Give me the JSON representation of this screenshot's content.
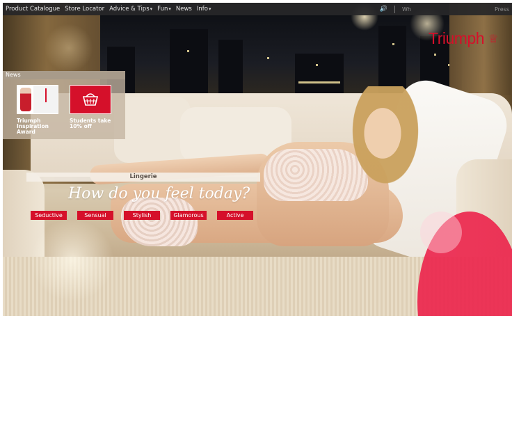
{
  "nav": {
    "items": [
      {
        "label": "Product Catalogue",
        "has_menu": false
      },
      {
        "label": "Store Locator",
        "has_menu": false
      },
      {
        "label": "Advice & Tips",
        "has_menu": true
      },
      {
        "label": "Fun",
        "has_menu": true
      },
      {
        "label": "News",
        "has_menu": false
      },
      {
        "label": "Info",
        "has_menu": true
      }
    ],
    "right_faint_1": "Wh",
    "right_faint_2": "Press"
  },
  "brand": {
    "name": "Triumph",
    "color": "#d5102a"
  },
  "news": {
    "heading": "News",
    "tiles": [
      {
        "label": "Triumph Inspiration Award",
        "thumb_icon": "award-model-thumbnail"
      },
      {
        "label": "Students take 10% off",
        "thumb_icon": "shopping-basket-icon"
      }
    ]
  },
  "lingerie": {
    "heading": "Lingerie",
    "tagline": "How do you feel today?",
    "moods": [
      "Seductive",
      "Sensual",
      "Stylish",
      "Glamorous",
      "Active"
    ]
  },
  "colors": {
    "accent": "#d5102a",
    "nav_bg": "#262628"
  }
}
